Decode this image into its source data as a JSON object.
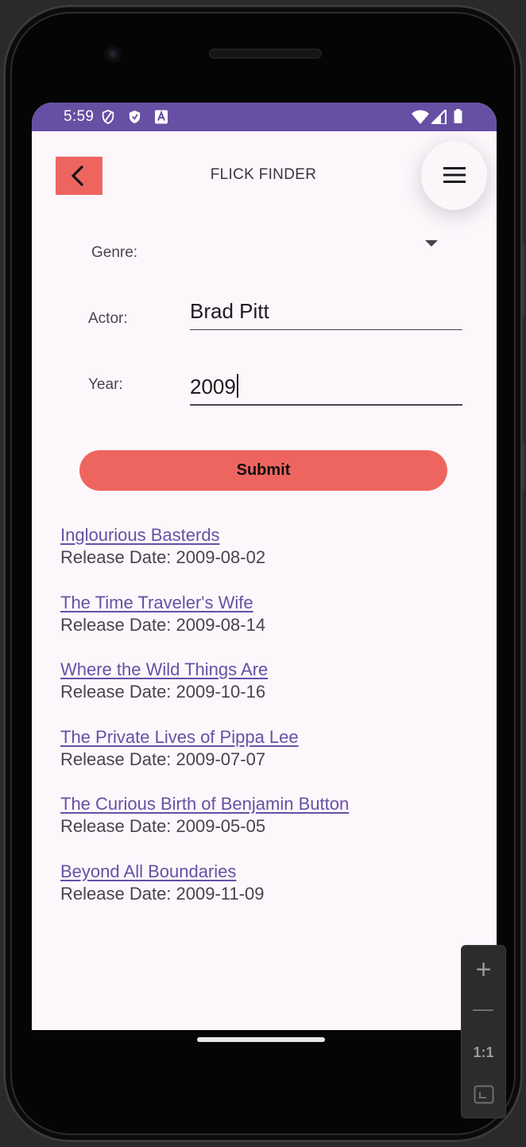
{
  "status_bar": {
    "time": "5:59",
    "icons": [
      "privacy-icon",
      "shield-icon",
      "a-badge-icon",
      "wifi-icon",
      "signal-icon",
      "battery-icon"
    ]
  },
  "header": {
    "title": "FLICK FINDER",
    "back_icon": "chevron-left-icon",
    "menu_icon": "hamburger-menu-icon"
  },
  "form": {
    "genre_label": "Genre:",
    "genre_value": "",
    "actor_label": "Actor:",
    "actor_value": "Brad Pitt",
    "year_label": "Year:",
    "year_value": "2009",
    "submit_label": "Submit"
  },
  "results": [
    {
      "title": "Inglourious Basterds",
      "release": "Release Date: 2009-08-02"
    },
    {
      "title": "The Time Traveler's Wife",
      "release": "Release Date: 2009-08-14"
    },
    {
      "title": "Where the Wild Things Are",
      "release": "Release Date: 2009-10-16"
    },
    {
      "title": "The Private Lives of Pippa Lee",
      "release": "Release Date: 2009-07-07"
    },
    {
      "title": "The Curious Birth of Benjamin Button",
      "release": "Release Date: 2009-05-05"
    },
    {
      "title": "Beyond All Boundaries",
      "release": "Release Date: 2009-11-09"
    }
  ],
  "emulator_zoom": {
    "zoom_in": "+",
    "reset": "1:1"
  },
  "colors": {
    "accent": "#6750a4",
    "button": "#ee6560",
    "background": "#fdf7fc"
  }
}
